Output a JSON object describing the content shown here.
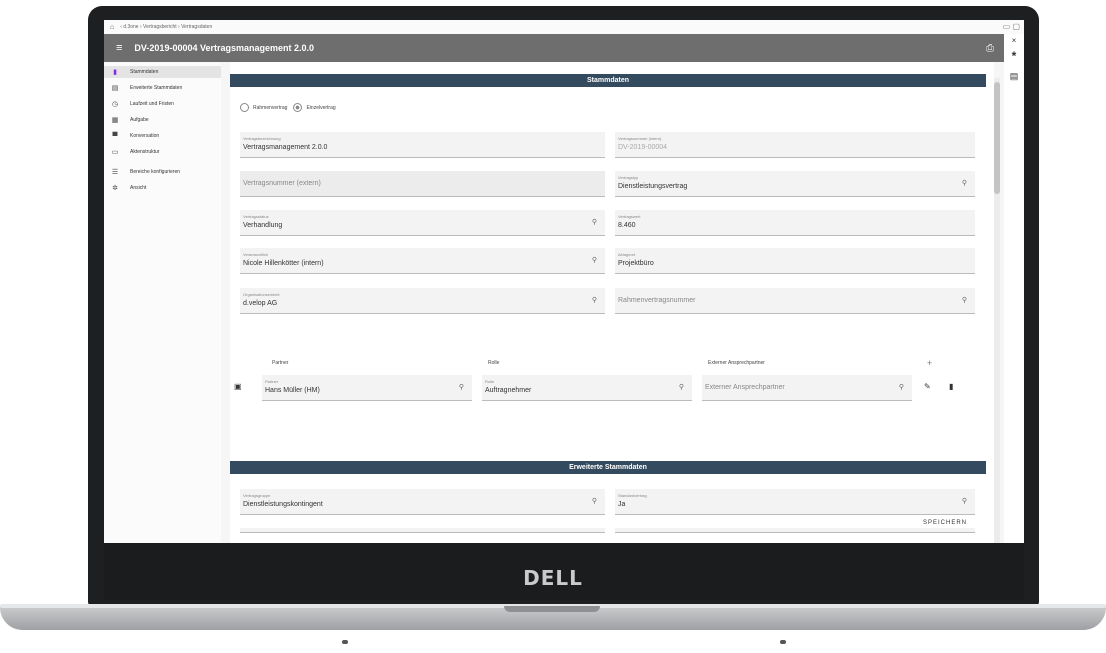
{
  "breadcrumb": {
    "home": "⌂",
    "path": "‹ d.3one › Vertragsbericht › Vertragsdaten"
  },
  "header": {
    "title": "DV-2019-00004 Vertragsmanagement 2.0.0"
  },
  "sidebar": {
    "items": [
      {
        "label": "Stammdaten",
        "icon": "document-icon"
      },
      {
        "label": "Erweiterte Stammdaten",
        "icon": "document-icon"
      },
      {
        "label": "Laufzeit und Fristen",
        "icon": "clock-icon"
      },
      {
        "label": "Aufgabe",
        "icon": "calendar-icon"
      },
      {
        "label": "Konversation",
        "icon": "chat-icon"
      },
      {
        "label": "Aktenstruktur",
        "icon": "folder-icon"
      },
      {
        "label": "Bereiche konfigurieren",
        "icon": "list-icon"
      },
      {
        "label": "Ansicht",
        "icon": "gear-icon"
      }
    ]
  },
  "sections": {
    "stammdaten": "Stammdaten",
    "erweiterte": "Erweiterte Stammdaten"
  },
  "radio": {
    "option1": "Rahmenvertrag",
    "option2": "Einzelvertrag"
  },
  "fields": {
    "vertragsbezeichnung": {
      "label": "Vertragsbezeichnung",
      "value": "Vertragsmanagement 2.0.0"
    },
    "vertragsnummer_intern": {
      "label": "Vertragsnummer (intern)",
      "value": "DV-2019-00004"
    },
    "vertragsnummer_extern": {
      "placeholder": "Vertragsnummer (extern)"
    },
    "vertragstyp": {
      "label": "Vertragstyp",
      "value": "Dienstleistungsvertrag"
    },
    "vertragsstatus": {
      "label": "Vertragsstatus",
      "value": "Verhandlung"
    },
    "vertragswert": {
      "label": "Vertragswert",
      "value": "8.460"
    },
    "verantwortlich": {
      "label": "Verantwortlich",
      "value": "Nicole Hillenkötter (intern)"
    },
    "ablageort": {
      "label": "Ablageort",
      "value": "Projektbüro"
    },
    "organisationseinheit": {
      "label": "Organisationseinheit",
      "value": "d.velop AG"
    },
    "rahmenvertragsnummer": {
      "placeholder": "Rahmenvertragsnummer"
    },
    "vertragsgruppe": {
      "label": "Vertragsgruppe",
      "value": "Dienstleistungskontingent"
    },
    "standardvertrag": {
      "label": "Standardvertrag",
      "value": "Ja"
    }
  },
  "partner_table": {
    "headers": [
      "Partner",
      "Rolle",
      "Externer Ansprechpartner"
    ],
    "row": {
      "partner_label": "Partner",
      "partner_value": "Hans Müller (HM)",
      "rolle_label": "Rolle",
      "rolle_value": "Auftragnehmer",
      "ansprech_placeholder": "Externer Ansprechpartner"
    }
  },
  "save_label": "SPEICHERN",
  "brand": "DELL"
}
